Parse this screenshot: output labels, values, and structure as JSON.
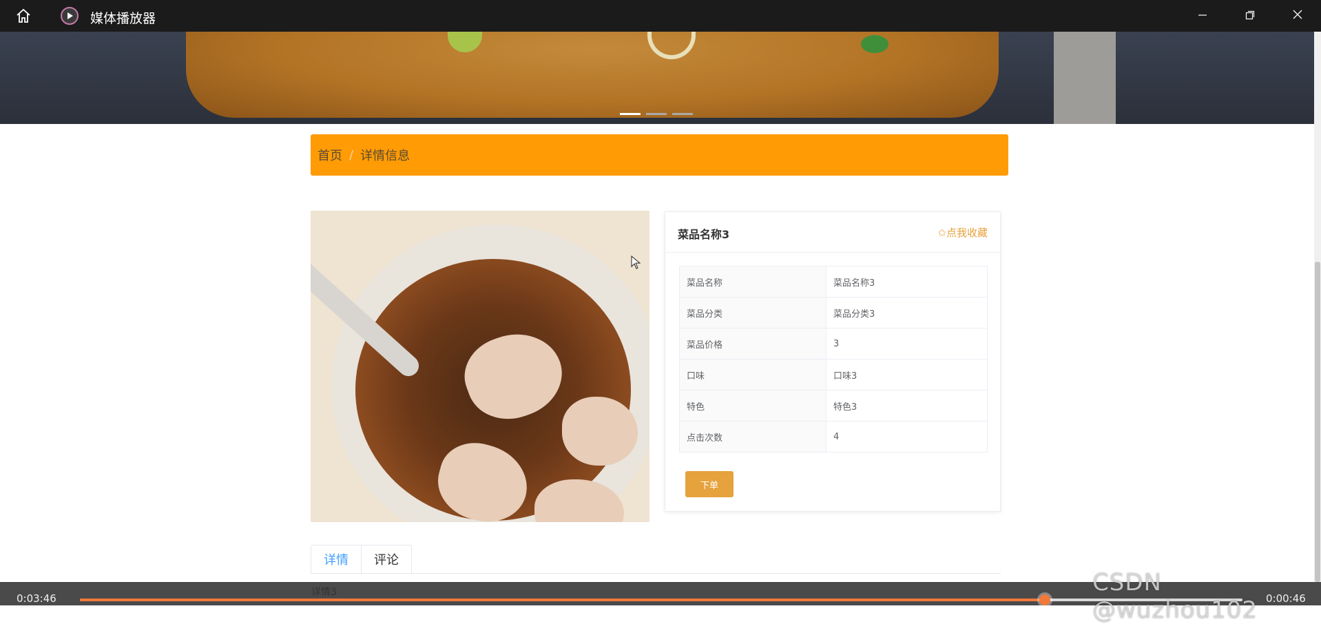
{
  "titlebar": {
    "app_title": "媒体播放器",
    "icons": [
      "home-icon",
      "media-player-icon",
      "minimize-icon",
      "maximize-icon",
      "close-icon"
    ]
  },
  "banner": {
    "carousel_dots": 3,
    "active_dot": 1
  },
  "breadcrumb": {
    "home": "首页",
    "separator": "/",
    "current": "详情信息"
  },
  "product": {
    "title": "菜品名称3",
    "favorite_label": "✩点我收藏",
    "rows": [
      {
        "label": "菜品名称",
        "value": "菜品名称3"
      },
      {
        "label": "菜品分类",
        "value": "菜品分类3"
      },
      {
        "label": "菜品价格",
        "value": "3"
      },
      {
        "label": "口味",
        "value": "口味3"
      },
      {
        "label": "特色",
        "value": "特色3"
      },
      {
        "label": "点击次数",
        "value": "4"
      }
    ],
    "order_button": "下单"
  },
  "tabs": {
    "detail": "详情",
    "comment": "评论",
    "active": "detail"
  },
  "player": {
    "current_time": "0:03:46",
    "remaining_time": "0:00:46",
    "progress": 0.83,
    "caption_text": "详情3"
  },
  "watermark": "CSDN @wuzhou102",
  "colors": {
    "breadcrumb_bg": "#ff9b05",
    "accent_orange": "#e6a23c",
    "tab_active": "#409eff",
    "progress": "#f2793a"
  }
}
